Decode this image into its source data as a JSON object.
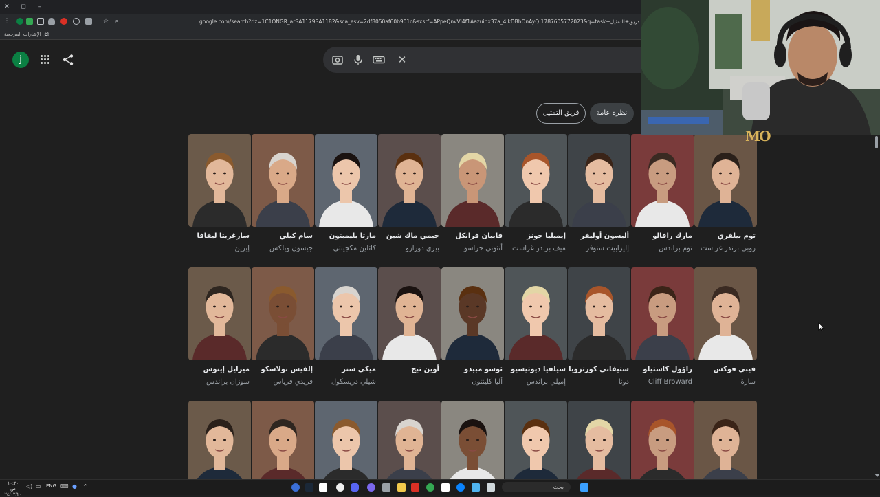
{
  "browser": {
    "url": "google.com/search?rlz=1C1ONGR_arSA1179SA1182&sca_esv=2df8050af60b901c&sxsrf=APpeQnvVI4f1Aazuipx37a_4ikDBhOnAyQ:1787605772023&q=task+فريق+التمثيل&sa=X&sqi=2&ved=2ahUKEwi8r6i4In",
    "bookmarks_label": "كل الإشارات المرجعية"
  },
  "google": {
    "avatar_letter": "j"
  },
  "chips": {
    "cast": "فريق التمثيل",
    "overview": "نظرة عامة"
  },
  "cast": [
    [
      {
        "actor": "سارغريتا ليفافا",
        "role": "إيرين"
      },
      {
        "actor": "سام كيلي",
        "role": "جيسون ويلكس"
      },
      {
        "actor": "مارثا بليمبتون",
        "role": "كاثلين مكجينتي"
      },
      {
        "actor": "جيمي ماك شين",
        "role": "بيري دورازو"
      },
      {
        "actor": "فابيان فرانكل",
        "role": "أنثوني جراسو"
      },
      {
        "actor": "إيميليا جونز",
        "role": "ميف برندر غراست"
      },
      {
        "actor": "أليسون أوليفر",
        "role": "إليزابيث ستوفر"
      },
      {
        "actor": "مارك رافالو",
        "role": "توم براندس"
      },
      {
        "actor": "توم بيلفري",
        "role": "روبي برندر غراست"
      }
    ],
    [
      {
        "actor": "ميرايل إينوس",
        "role": "سوزان براندس"
      },
      {
        "actor": "إلفيس نولاسكو",
        "role": "فريدي فرياس"
      },
      {
        "actor": "ميكي سنر",
        "role": "شيلي دريسكول"
      },
      {
        "actor": "أوين تيج",
        "role": ""
      },
      {
        "actor": "ثوسو مبيدو",
        "role": "أليا كلينتون"
      },
      {
        "actor": "سيلفيا ديوتيسيو",
        "role": "إميلي براندس"
      },
      {
        "actor": "ستيفاني كورتزوبا",
        "role": "دونا"
      },
      {
        "actor": "راؤول كاستيلو",
        "role": "Cliff Broward"
      },
      {
        "actor": "فيبي فوكس",
        "role": "سارة"
      }
    ]
  ],
  "webcam": {
    "logo": "MO"
  },
  "taskbar": {
    "search_label": "بحث",
    "lang": "ENG",
    "time": "١٠:٣٠ ص",
    "date": "٢٤/٠٢/٢٠"
  },
  "colors": {
    "page_bg": "#1f1f1f",
    "avatar_bg": "#0b8043",
    "muted_text": "#9aa0a6"
  }
}
